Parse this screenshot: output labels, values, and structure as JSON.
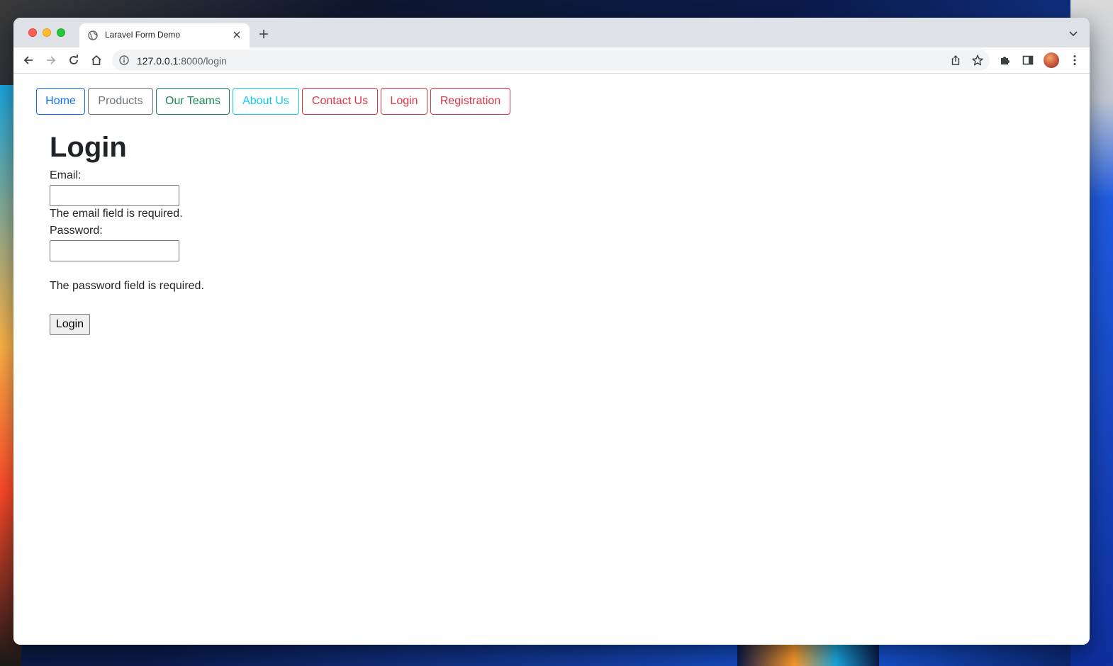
{
  "browser": {
    "tab_title": "Laravel Form Demo",
    "url_host": "127.0.0.1",
    "url_path": ":8000/login"
  },
  "nav": {
    "buttons": [
      {
        "label": "Home",
        "color": "#0d6efd"
      },
      {
        "label": "Products",
        "color": "#6c757d"
      },
      {
        "label": "Our Teams",
        "color": "#198754"
      },
      {
        "label": "About Us",
        "color": "#0dcaf0"
      },
      {
        "label": "Contact Us",
        "color": "#dc3545"
      },
      {
        "label": "Login",
        "color": "#dc3545"
      },
      {
        "label": "Registration",
        "color": "#dc3545"
      }
    ]
  },
  "form": {
    "title": "Login",
    "email_label": "Email:",
    "email_value": "",
    "email_error": "The email field is required.",
    "password_label": "Password:",
    "password_value": "",
    "password_error": "The password field is required.",
    "submit_label": "Login"
  },
  "icons": {
    "tab": "globe-icon",
    "close": "close-icon",
    "new_tab": "plus-icon",
    "back": "arrow-left-icon",
    "forward": "arrow-right-icon",
    "reload": "reload-icon",
    "home": "home-icon",
    "info": "info-icon",
    "share": "share-icon",
    "bookmark": "star-icon",
    "extensions": "puzzle-icon",
    "side_panel": "side-panel-icon",
    "menu": "kebab-menu-icon"
  }
}
